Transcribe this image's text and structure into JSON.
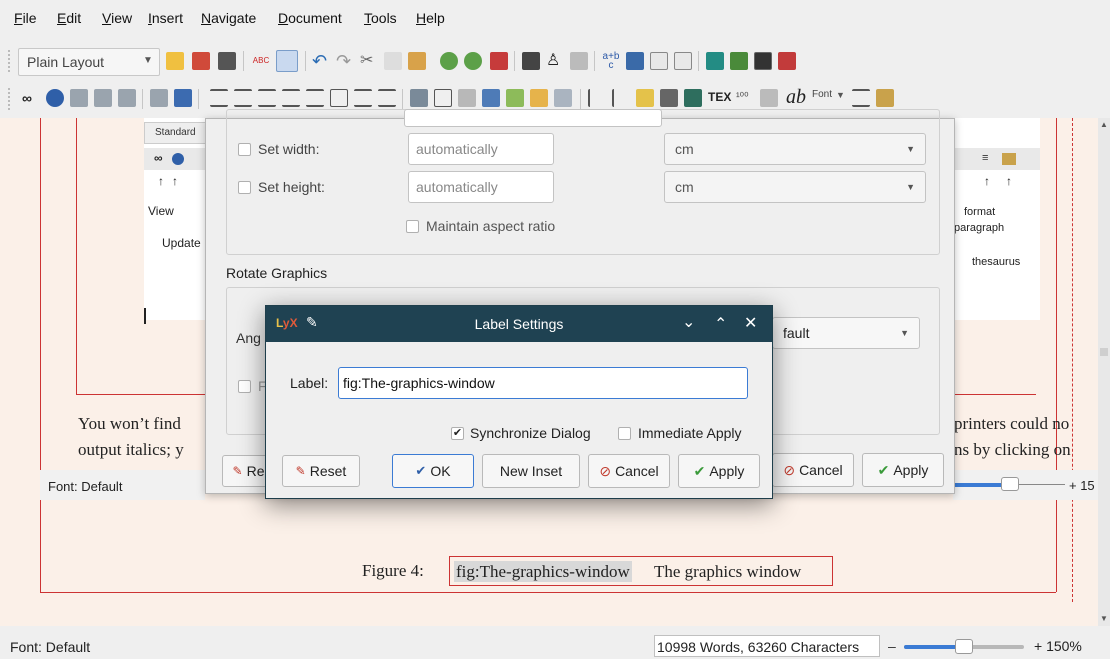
{
  "menubar": {
    "items": [
      {
        "label": "File",
        "ul": "F",
        "rest": "ile"
      },
      {
        "label": "Edit",
        "ul": "E",
        "rest": "dit"
      },
      {
        "label": "View",
        "ul": "V",
        "rest": "iew"
      },
      {
        "label": "Insert",
        "ul": "I",
        "rest": "nsert"
      },
      {
        "label": "Navigate",
        "ul": "N",
        "rest": "avigate"
      },
      {
        "label": "Document",
        "ul": "D",
        "rest": "ocument"
      },
      {
        "label": "Tools",
        "ul": "T",
        "rest": "ools"
      },
      {
        "label": "Help",
        "ul": "H",
        "rest": "elp"
      }
    ]
  },
  "toolbar": {
    "layout_combo": "Plain Layout",
    "font_label": "Font",
    "ab_label": "ab"
  },
  "document": {
    "embedded_screenshot": {
      "standard_label": "Standard",
      "view_label": "View",
      "update_label": "Update",
      "format_label": "format",
      "paragraph_label": "paragraph",
      "thesaurus_label": "thesaurus"
    },
    "paragraph_line1_left": "You won’t find",
    "paragraph_line1_right": "printers could no",
    "paragraph_line2_left": "output italics; y",
    "paragraph_line2_right": "ns by clicking on",
    "inner_status_font": "Font: Default",
    "inner_zoom": "+ 15",
    "figure_prefix": "Figure 4:",
    "figure_label": "fig:The-graphics-window",
    "figure_caption": "The graphics window"
  },
  "graphics_dialog": {
    "set_width_label": "Set width:",
    "set_width_ul": "w",
    "set_width_value": "automatically",
    "set_width_unit": "cm",
    "set_height_label": "Set height:",
    "set_height_ul": "h",
    "set_height_value": "automatically",
    "set_height_unit": "cm",
    "maintain_aspect": "Maintain aspect ratio",
    "maintain_ul": "M",
    "rotate_section": "Rotate Graphics",
    "angle_label_partial": "Ang",
    "origin_select": "fault",
    "reset_partial": "Res",
    "cancel_label": "Cancel",
    "apply_label": "Apply"
  },
  "label_dialog": {
    "title": "Label Settings",
    "label_caption": "Label:",
    "label_value": "fig:The-graphics-window",
    "sync_label": "Synchronize Dialog",
    "sync_checked": true,
    "immediate_label": "Immediate Apply",
    "immediate_checked": false,
    "reset_button": "Reset",
    "ok_button": "OK",
    "new_inset_button": "New Inset",
    "cancel_button": "Cancel",
    "apply_button": "Apply"
  },
  "statusbar": {
    "font": "Font: Default",
    "counts": "10998 Words, 63260 Characters",
    "zoom_minus": "–",
    "zoom": "+ 150%",
    "zoom_level_fraction": 0.5
  },
  "colors": {
    "doc_bg": "#fbf0e8",
    "title_bar": "#1f4252",
    "accent_blue": "#3b7bd4",
    "red_frame": "#cc3333"
  }
}
